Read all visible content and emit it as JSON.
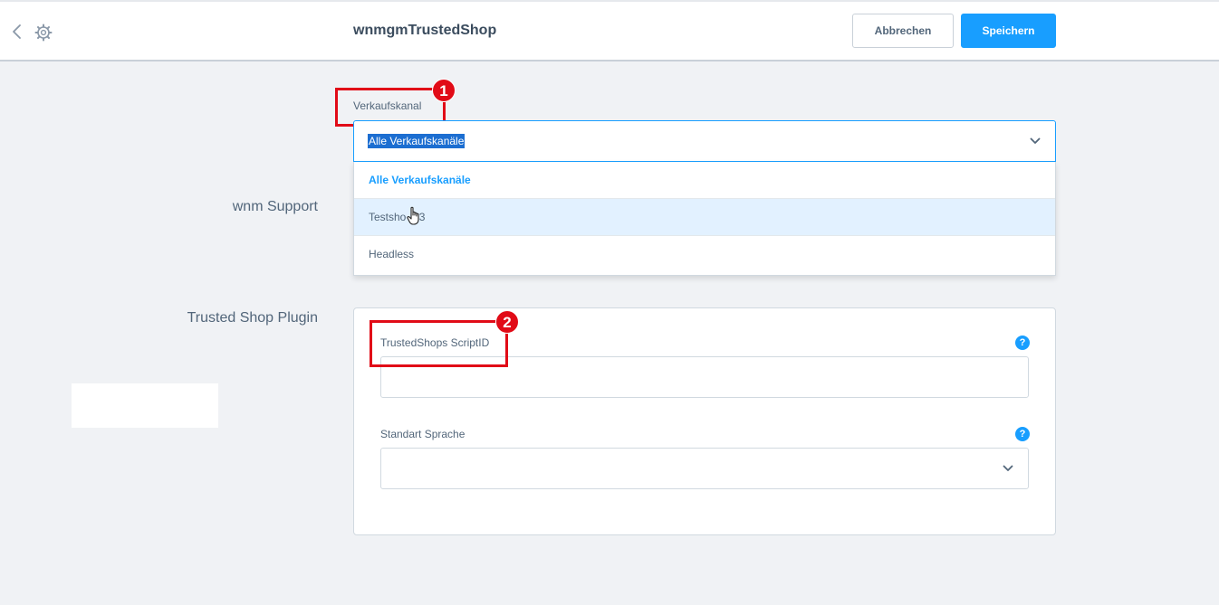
{
  "header": {
    "title": "wnmgmTrustedShop",
    "cancel_label": "Abbrechen",
    "save_label": "Speichern"
  },
  "sales_channel": {
    "label": "Verkaufskanal",
    "selected_value": "Alle Verkaufskanäle",
    "options": [
      {
        "label": "Alle Verkaufskanäle",
        "state": "selected"
      },
      {
        "label": "Testsho",
        "suffix": ".3",
        "state": "hover"
      },
      {
        "label": "Headless",
        "state": "normal"
      }
    ]
  },
  "sections": {
    "support_title": "wnm Support",
    "plugin_title": "Trusted Shop Plugin"
  },
  "plugin_card": {
    "script_id_label": "TrustedShops ScriptID",
    "script_id_value": "",
    "language_label": "Standart Sprache",
    "language_value": ""
  },
  "annotations": {
    "badge_1": "1",
    "badge_2": "2",
    "highlight_color": "#e10b17"
  },
  "colors": {
    "accent": "#189eff",
    "text": "#52667a"
  },
  "icons": [
    "back-icon",
    "gear-icon",
    "chevron-down-icon",
    "help-icon",
    "hand-cursor-icon"
  ]
}
